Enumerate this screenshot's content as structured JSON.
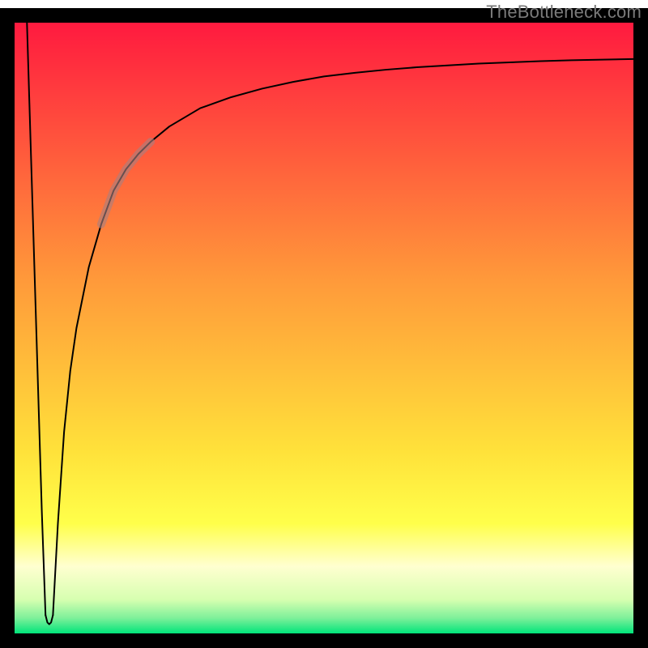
{
  "watermark": "TheBottleneck.com",
  "chart_data": {
    "type": "line",
    "title": "",
    "xlabel": "",
    "ylabel": "",
    "xlim": [
      0,
      100
    ],
    "ylim": [
      0,
      100
    ],
    "grid": false,
    "legend": false,
    "background_gradient_stops": [
      {
        "offset": 0.0,
        "color": "#ff1a3f"
      },
      {
        "offset": 0.42,
        "color": "#ff993a"
      },
      {
        "offset": 0.7,
        "color": "#ffe13a"
      },
      {
        "offset": 0.82,
        "color": "#ffff4a"
      },
      {
        "offset": 0.89,
        "color": "#ffffd0"
      },
      {
        "offset": 0.945,
        "color": "#d6ffb0"
      },
      {
        "offset": 0.975,
        "color": "#7df09a"
      },
      {
        "offset": 1.0,
        "color": "#00e47a"
      }
    ],
    "annotations": [
      {
        "name": "highlight-segment",
        "x_range": [
          14,
          22
        ],
        "color": "#a88080",
        "opacity": 0.62,
        "stroke_width": 10
      }
    ],
    "series": [
      {
        "name": "left-drop",
        "color": "#000000",
        "stroke_width": 2,
        "x": [
          2.0,
          2.6,
          3.2,
          3.8,
          4.4,
          5.0
        ],
        "y": [
          100.0,
          80.0,
          60.0,
          40.0,
          20.0,
          3.0
        ]
      },
      {
        "name": "dip-bottom",
        "color": "#000000",
        "stroke_width": 2,
        "x": [
          5.0,
          5.3,
          5.6,
          5.9,
          6.2
        ],
        "y": [
          3.0,
          1.8,
          1.5,
          1.8,
          3.0
        ]
      },
      {
        "name": "recovery-curve",
        "color": "#000000",
        "stroke_width": 2,
        "x": [
          6.2,
          7,
          8,
          9,
          10,
          12,
          14,
          16,
          18,
          20,
          22,
          25,
          30,
          35,
          40,
          45,
          50,
          55,
          60,
          65,
          70,
          75,
          80,
          85,
          90,
          95,
          100
        ],
        "y": [
          3.0,
          18,
          33,
          43,
          50,
          60,
          67,
          72.5,
          76,
          78.5,
          80.5,
          83,
          86,
          87.8,
          89.2,
          90.3,
          91.2,
          91.8,
          92.3,
          92.7,
          93.0,
          93.3,
          93.5,
          93.7,
          93.85,
          93.95,
          94.05
        ]
      }
    ]
  }
}
